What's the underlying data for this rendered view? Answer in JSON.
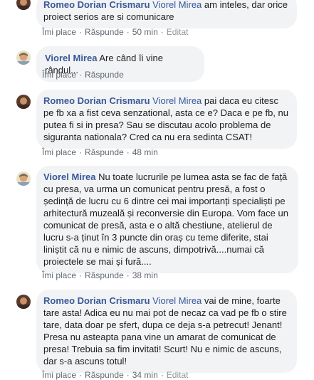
{
  "labels": {
    "like": "Îmi place",
    "reply": "Răspunde",
    "edited": "Editat",
    "dot": "·"
  },
  "comments": [
    {
      "author": "Romeo Dorian Crismaru",
      "mention": "Viorel Mirea",
      "line1_rest": " am inteles, dar orice",
      "text": "proiect serios are si comunicare",
      "time": "50 min",
      "edited": true
    },
    {
      "author": "Viorel Mirea",
      "text": " Are când îi vine rândul...",
      "time": ""
    },
    {
      "author": "Romeo Dorian Crismaru",
      "mention": "Viorel Mirea",
      "text": " pai daca eu citesc pe fb xa a fist ceva senzational, asta ce e? Daca e pe fb, nu putea fi si in presa? Sau se discutau acolo problema de siguranta nationala? Cred ca nu era sedinta CSAT!",
      "time": "48 min"
    },
    {
      "author": "Viorel Mirea",
      "text": " Nu toate lucrurile pe lumea asta se fac de față cu presa, va urma un comunicat pentru presă, a fost o ședință de lucru cu 6 dintre cei mai importanți specialiști pe arhitectură muzeală și reconversie din Europa. Vom face un comunicat de presă, asta e o altă chestiune, atelierul de lucru s-a ținut în 3 puncte din oraș cu teme diferite, stai liniștit că nu e nimic de ascuns, dimpotrivă....numai că proiectele se mai și fură....",
      "time": "38 min"
    },
    {
      "author": "Romeo Dorian Crismaru",
      "mention": "Viorel Mirea",
      "text": " vai de mine, foarte tare asta! Adica eu nu mai pot de necaz ca vad pe fb o stire tare, data doar pe sfert, dupa ce deja s-a petrecut! Jenant! Presa nu asteapta pana vine un amarat de comunicat de presa! Trebuia sa fim invitati! Scurt! Nu e nimic de ascuns, dar s-a ascuns totul!",
      "time": "34 min",
      "edited": true
    }
  ],
  "colors": {
    "link": "#385898",
    "bubble": "#f2f3f5",
    "meta": "#606770"
  }
}
